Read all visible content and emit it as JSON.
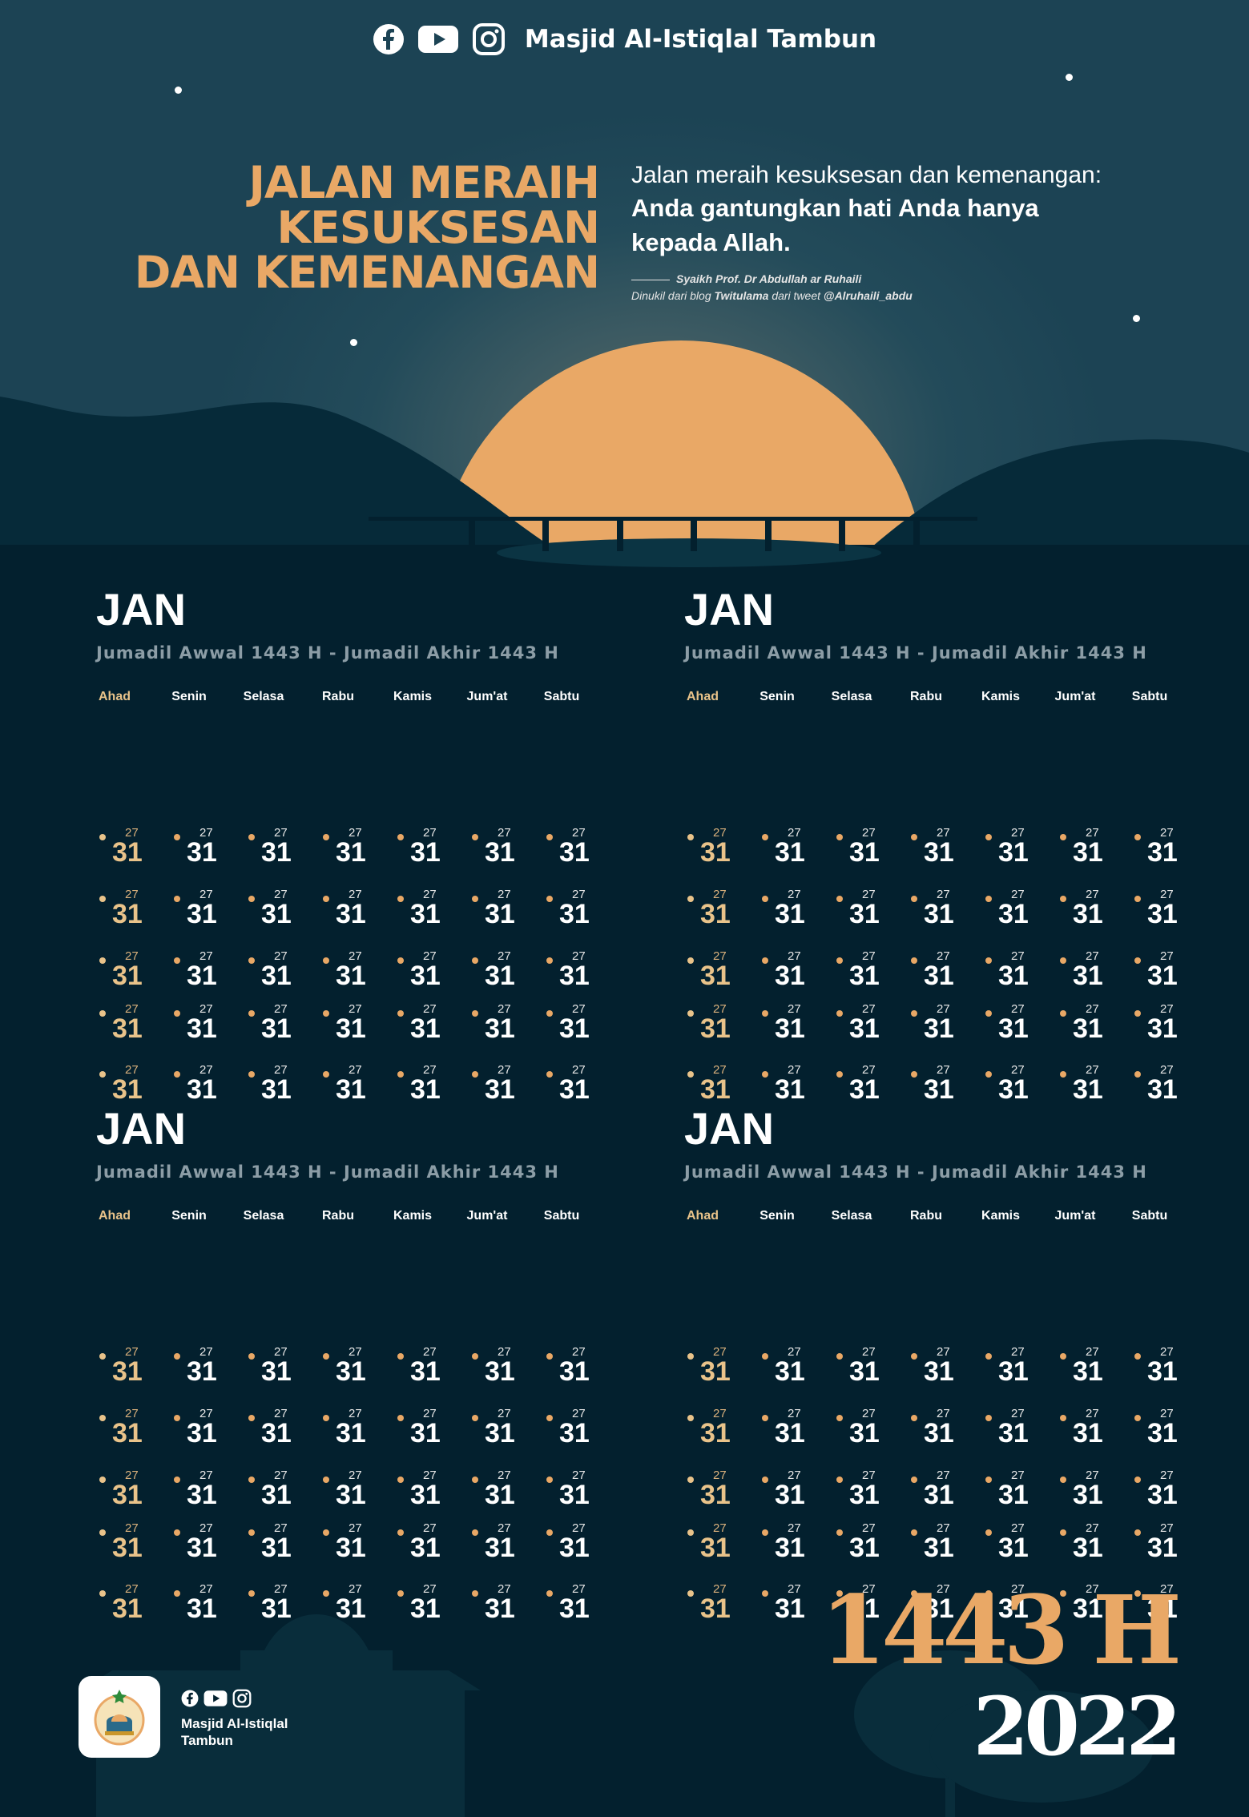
{
  "brand": {
    "name": "Masjid Al-Istiqlal Tambun",
    "footer_name_line1": "Masjid Al-Istiqlal",
    "footer_name_line2": "Tambun",
    "social_icons": [
      "facebook-icon",
      "youtube-icon",
      "instagram-icon"
    ]
  },
  "headline": {
    "line1": "JALAN MERAIH",
    "line2": "KESUKSESAN",
    "line3": "DAN KEMENANGAN"
  },
  "quote": {
    "intro": "Jalan meraih kesuksesan dan kemenangan:",
    "line1": "Anda gantungkan hati Anda hanya",
    "line2": "kepada Allah.",
    "author": "Syaikh Prof. Dr Abdullah ar Ruhaili",
    "source_prefix": "Dinukil dari blog ",
    "source_blog": "Twitulama",
    "source_mid": " dari tweet ",
    "source_handle": "@Alruhaili_abdu"
  },
  "calendars": [
    {
      "month": "JAN",
      "hijri_range": "Jumadil Awwal 1443 H - Jumadil Akhir 1443 H",
      "day_names": [
        "Ahad",
        "Senin",
        "Selasa",
        "Rabu",
        "Kamis",
        "Jum'at",
        "Sabtu"
      ],
      "weeks": [
        [
          {
            "g": "31",
            "h": "27"
          },
          {
            "g": "31",
            "h": "27"
          },
          {
            "g": "31",
            "h": "27"
          },
          {
            "g": "31",
            "h": "27"
          },
          {
            "g": "31",
            "h": "27"
          },
          {
            "g": "31",
            "h": "27"
          },
          {
            "g": "31",
            "h": "27"
          }
        ],
        [
          {
            "g": "31",
            "h": "27"
          },
          {
            "g": "31",
            "h": "27"
          },
          {
            "g": "31",
            "h": "27"
          },
          {
            "g": "31",
            "h": "27"
          },
          {
            "g": "31",
            "h": "27"
          },
          {
            "g": "31",
            "h": "27"
          },
          {
            "g": "31",
            "h": "27"
          }
        ],
        [
          {
            "g": "31",
            "h": "27"
          },
          {
            "g": "31",
            "h": "27"
          },
          {
            "g": "31",
            "h": "27"
          },
          {
            "g": "31",
            "h": "27"
          },
          {
            "g": "31",
            "h": "27"
          },
          {
            "g": "31",
            "h": "27"
          },
          {
            "g": "31",
            "h": "27"
          }
        ],
        [
          {
            "g": "31",
            "h": "27"
          },
          {
            "g": "31",
            "h": "27"
          },
          {
            "g": "31",
            "h": "27"
          },
          {
            "g": "31",
            "h": "27"
          },
          {
            "g": "31",
            "h": "27"
          },
          {
            "g": "31",
            "h": "27"
          },
          {
            "g": "31",
            "h": "27"
          }
        ],
        [
          {
            "g": "31",
            "h": "27"
          },
          {
            "g": "31",
            "h": "27"
          },
          {
            "g": "31",
            "h": "27"
          },
          {
            "g": "31",
            "h": "27"
          },
          {
            "g": "31",
            "h": "27"
          },
          {
            "g": "31",
            "h": "27"
          },
          {
            "g": "31",
            "h": "27"
          }
        ]
      ]
    },
    {
      "month": "JAN",
      "hijri_range": "Jumadil Awwal 1443 H - Jumadil Akhir 1443 H",
      "day_names": [
        "Ahad",
        "Senin",
        "Selasa",
        "Rabu",
        "Kamis",
        "Jum'at",
        "Sabtu"
      ],
      "weeks": [
        [
          {
            "g": "31",
            "h": "27"
          },
          {
            "g": "31",
            "h": "27"
          },
          {
            "g": "31",
            "h": "27"
          },
          {
            "g": "31",
            "h": "27"
          },
          {
            "g": "31",
            "h": "27"
          },
          {
            "g": "31",
            "h": "27"
          },
          {
            "g": "31",
            "h": "27"
          }
        ],
        [
          {
            "g": "31",
            "h": "27"
          },
          {
            "g": "31",
            "h": "27"
          },
          {
            "g": "31",
            "h": "27"
          },
          {
            "g": "31",
            "h": "27"
          },
          {
            "g": "31",
            "h": "27"
          },
          {
            "g": "31",
            "h": "27"
          },
          {
            "g": "31",
            "h": "27"
          }
        ],
        [
          {
            "g": "31",
            "h": "27"
          },
          {
            "g": "31",
            "h": "27"
          },
          {
            "g": "31",
            "h": "27"
          },
          {
            "g": "31",
            "h": "27"
          },
          {
            "g": "31",
            "h": "27"
          },
          {
            "g": "31",
            "h": "27"
          },
          {
            "g": "31",
            "h": "27"
          }
        ],
        [
          {
            "g": "31",
            "h": "27"
          },
          {
            "g": "31",
            "h": "27"
          },
          {
            "g": "31",
            "h": "27"
          },
          {
            "g": "31",
            "h": "27"
          },
          {
            "g": "31",
            "h": "27"
          },
          {
            "g": "31",
            "h": "27"
          },
          {
            "g": "31",
            "h": "27"
          }
        ],
        [
          {
            "g": "31",
            "h": "27"
          },
          {
            "g": "31",
            "h": "27"
          },
          {
            "g": "31",
            "h": "27"
          },
          {
            "g": "31",
            "h": "27"
          },
          {
            "g": "31",
            "h": "27"
          },
          {
            "g": "31",
            "h": "27"
          },
          {
            "g": "31",
            "h": "27"
          }
        ]
      ]
    },
    {
      "month": "JAN",
      "hijri_range": "Jumadil Awwal 1443 H - Jumadil Akhir 1443 H",
      "day_names": [
        "Ahad",
        "Senin",
        "Selasa",
        "Rabu",
        "Kamis",
        "Jum'at",
        "Sabtu"
      ],
      "weeks": [
        [
          {
            "g": "31",
            "h": "27"
          },
          {
            "g": "31",
            "h": "27"
          },
          {
            "g": "31",
            "h": "27"
          },
          {
            "g": "31",
            "h": "27"
          },
          {
            "g": "31",
            "h": "27"
          },
          {
            "g": "31",
            "h": "27"
          },
          {
            "g": "31",
            "h": "27"
          }
        ],
        [
          {
            "g": "31",
            "h": "27"
          },
          {
            "g": "31",
            "h": "27"
          },
          {
            "g": "31",
            "h": "27"
          },
          {
            "g": "31",
            "h": "27"
          },
          {
            "g": "31",
            "h": "27"
          },
          {
            "g": "31",
            "h": "27"
          },
          {
            "g": "31",
            "h": "27"
          }
        ],
        [
          {
            "g": "31",
            "h": "27"
          },
          {
            "g": "31",
            "h": "27"
          },
          {
            "g": "31",
            "h": "27"
          },
          {
            "g": "31",
            "h": "27"
          },
          {
            "g": "31",
            "h": "27"
          },
          {
            "g": "31",
            "h": "27"
          },
          {
            "g": "31",
            "h": "27"
          }
        ],
        [
          {
            "g": "31",
            "h": "27"
          },
          {
            "g": "31",
            "h": "27"
          },
          {
            "g": "31",
            "h": "27"
          },
          {
            "g": "31",
            "h": "27"
          },
          {
            "g": "31",
            "h": "27"
          },
          {
            "g": "31",
            "h": "27"
          },
          {
            "g": "31",
            "h": "27"
          }
        ],
        [
          {
            "g": "31",
            "h": "27"
          },
          {
            "g": "31",
            "h": "27"
          },
          {
            "g": "31",
            "h": "27"
          },
          {
            "g": "31",
            "h": "27"
          },
          {
            "g": "31",
            "h": "27"
          },
          {
            "g": "31",
            "h": "27"
          },
          {
            "g": "31",
            "h": "27"
          }
        ]
      ]
    },
    {
      "month": "JAN",
      "hijri_range": "Jumadil Awwal 1443 H - Jumadil Akhir 1443 H",
      "day_names": [
        "Ahad",
        "Senin",
        "Selasa",
        "Rabu",
        "Kamis",
        "Jum'at",
        "Sabtu"
      ],
      "weeks": [
        [
          {
            "g": "31",
            "h": "27"
          },
          {
            "g": "31",
            "h": "27"
          },
          {
            "g": "31",
            "h": "27"
          },
          {
            "g": "31",
            "h": "27"
          },
          {
            "g": "31",
            "h": "27"
          },
          {
            "g": "31",
            "h": "27"
          },
          {
            "g": "31",
            "h": "27"
          }
        ],
        [
          {
            "g": "31",
            "h": "27"
          },
          {
            "g": "31",
            "h": "27"
          },
          {
            "g": "31",
            "h": "27"
          },
          {
            "g": "31",
            "h": "27"
          },
          {
            "g": "31",
            "h": "27"
          },
          {
            "g": "31",
            "h": "27"
          },
          {
            "g": "31",
            "h": "27"
          }
        ],
        [
          {
            "g": "31",
            "h": "27"
          },
          {
            "g": "31",
            "h": "27"
          },
          {
            "g": "31",
            "h": "27"
          },
          {
            "g": "31",
            "h": "27"
          },
          {
            "g": "31",
            "h": "27"
          },
          {
            "g": "31",
            "h": "27"
          },
          {
            "g": "31",
            "h": "27"
          }
        ],
        [
          {
            "g": "31",
            "h": "27"
          },
          {
            "g": "31",
            "h": "27"
          },
          {
            "g": "31",
            "h": "27"
          },
          {
            "g": "31",
            "h": "27"
          },
          {
            "g": "31",
            "h": "27"
          },
          {
            "g": "31",
            "h": "27"
          },
          {
            "g": "31",
            "h": "27"
          }
        ],
        [
          {
            "g": "31",
            "h": "27"
          },
          {
            "g": "31",
            "h": "27"
          },
          {
            "g": "31",
            "h": "27"
          },
          {
            "g": "31",
            "h": "27"
          },
          {
            "g": "31",
            "h": "27"
          },
          {
            "g": "31",
            "h": "27"
          },
          {
            "g": "31",
            "h": "27"
          }
        ]
      ]
    }
  ],
  "year": {
    "hijri": "1443 H",
    "gregorian": "2022"
  },
  "colors": {
    "accent_orange": "#e9a866",
    "accent_gold": "#e9c38a",
    "background": "#03202e",
    "sky": "#1c4354"
  }
}
